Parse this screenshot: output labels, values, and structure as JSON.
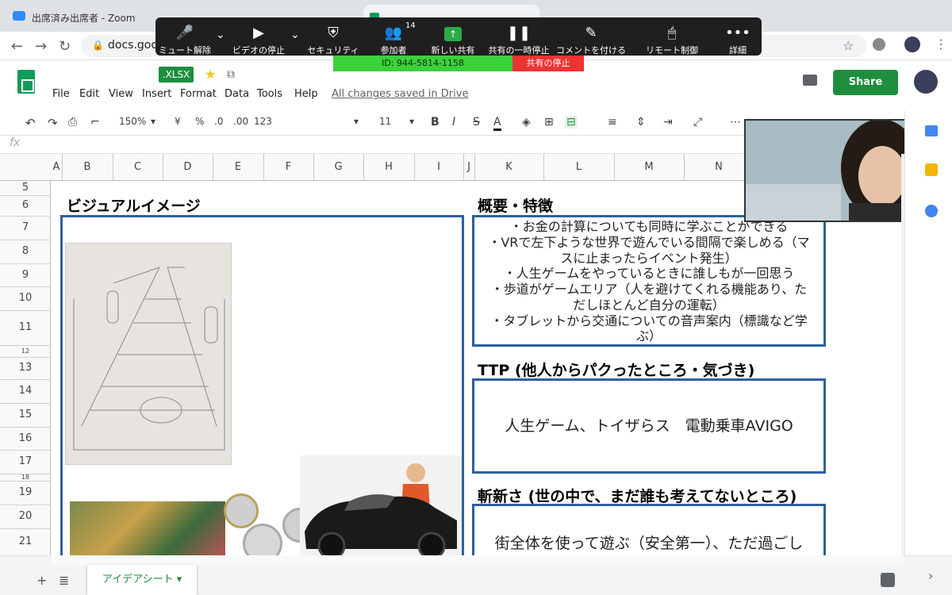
{
  "browser": {
    "window_title": "出席済み出席者 - Zoom",
    "url": "docs.goog"
  },
  "zoom": {
    "mute_label": "ミュート解除",
    "video_label": "ビデオの停止",
    "security_label": "セキュリティ",
    "participants_label": "参加者",
    "participants_count": "14",
    "new_share_label": "新しい共有",
    "pause_share_label": "共有の一時停止",
    "annotate_label": "コメントを付ける",
    "remote_label": "リモート制御",
    "more_label": "詳細",
    "meeting_id": "ID: 944-5814-1158",
    "stop_share_label": "共有の停止"
  },
  "sheets": {
    "badge": ".XLSX",
    "menu": [
      "File",
      "Edit",
      "View",
      "Insert",
      "Format",
      "Data",
      "Tools",
      "Help"
    ],
    "saved_status": "All changes saved in Drive",
    "share_label": "Share",
    "toolbar": {
      "zoom": "150%",
      "currency": "¥",
      "percent": "%",
      "dec_less": ".0",
      "dec_more": ".00",
      "format": "123",
      "font_size": "11",
      "bold": "B",
      "italic": "I",
      "strike": "S",
      "text_color": "A",
      "more": "⋯"
    },
    "fx": "fx",
    "columns": [
      "A",
      "B",
      "C",
      "D",
      "E",
      "F",
      "G",
      "H",
      "I",
      "J",
      "K",
      "L",
      "M",
      "N"
    ],
    "rows": [
      "5",
      "6",
      "7",
      "8",
      "9",
      "10",
      "11",
      "12",
      "13",
      "14",
      "15",
      "16",
      "17",
      "18",
      "19",
      "20",
      "21"
    ],
    "sheet_tab": "アイデアシート"
  },
  "content": {
    "visual_heading": "ビジュアルイメージ",
    "overview_heading": "概要・特徴",
    "overview_lines": [
      "・お金の計算についても同時に学ぶことができる",
      "・VRで左下ような世界で遊んでいる間隔で楽しめる（マ",
      "スに止まったらイベント発生）",
      "・人生ゲームをやっているときに誰しもが一回思う",
      "・歩道がゲームエリア（人を避けてくれる機能あり、た",
      "だしほとんど自分の運転）",
      "・タブレットから交通についての音声案内（標識など学",
      "ぶ）"
    ],
    "ttp_heading": "TTP (他人からパクったところ・気づき)",
    "ttp_text": "人生ゲーム、トイザらス　電動乗車AVIGO",
    "novelty_heading": "斬新さ (世の中で、まだ誰も考えてないところ)",
    "novelty_text": "街全体を使って遊ぶ（安全第一）、ただ過ごし"
  },
  "colors": {
    "zoom_bar": "#1f1f1f",
    "meeting_green": "#3bd13b",
    "stop_red": "#e33333",
    "sheets_green": "#1e8e3e",
    "box_border": "#2f5f9e"
  }
}
